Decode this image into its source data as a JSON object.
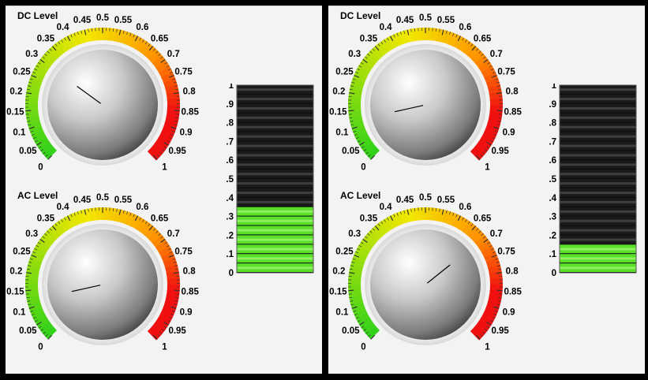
{
  "scale_labels": [
    "0",
    "0.05",
    "0.1",
    "0.15",
    "0.2",
    "0.25",
    "0.3",
    "0.35",
    "0.4",
    "0.45",
    "0.5",
    "0.55",
    "0.6",
    "0.65",
    "0.7",
    "0.75",
    "0.8",
    "0.85",
    "0.9",
    "0.95",
    "1"
  ],
  "meter_labels": [
    "1",
    ".9",
    ".8",
    ".7",
    ".6",
    ".5",
    ".4",
    ".3",
    ".2",
    ".1",
    "0"
  ],
  "colors": {
    "panel_bg": "#f3f3f3",
    "gauge_low": "#2fd21b",
    "gauge_mid": "#f2e800",
    "gauge_orange": "#ff9200",
    "gauge_high": "#f01010",
    "meter_on": "#5be02a",
    "meter_off": "#0a0a0a"
  },
  "panels": [
    {
      "dc": {
        "label": "DC Level",
        "value": 0.3
      },
      "ac": {
        "label": "AC Level",
        "value": 0.12
      },
      "meter": {
        "value": 0.35
      }
    },
    {
      "dc": {
        "label": "DC Level",
        "value": 0.12
      },
      "ac": {
        "label": "AC Level",
        "value": 0.69
      },
      "meter": {
        "value": 0.14
      }
    }
  ]
}
